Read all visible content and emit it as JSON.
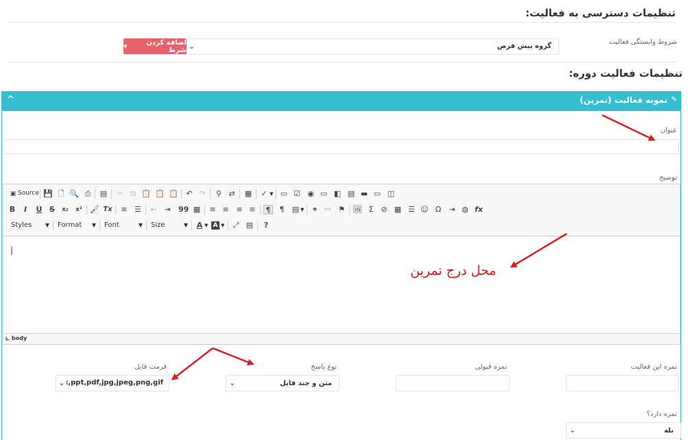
{
  "access": {
    "heading": "تنظیمات دسترسی به فعالیت:",
    "dependency_label": "شروط وابستگی فعالیت",
    "dependency_value": "گروه پیش فرض",
    "add_condition_button": "اضافه کردن شرط"
  },
  "course": {
    "heading": "تنظیمات فعالیت دوره:"
  },
  "panel": {
    "title": "نمونه فعالیت (تمرین)",
    "title_label": "عنوان",
    "description_label": "توضیح",
    "editor_placeholder": "|",
    "status_path": "body",
    "annotation_text": "محل درج تمرین"
  },
  "toolbar": {
    "source_label": "Source",
    "styles_label": "Styles",
    "format_label": "Format",
    "font_label": "Font",
    "size_label": "Size",
    "bold": "B",
    "italic": "I",
    "underline": "U",
    "strike": "S",
    "subscript": "x₂",
    "superscript": "x²",
    "remove_format": "Tx",
    "blockquote": "99",
    "help": "?",
    "omega": "Ω",
    "sigma": "Σ",
    "fx": "fx",
    "text_color": "A",
    "bg_color": "A"
  },
  "bottom": {
    "activity_score_label": "نمره این فعالیت",
    "pass_score_label": "نمره قبولی",
    "answer_type_label": "نوع پاسخ",
    "answer_type_value": "متن و چند فایل",
    "file_format_label": "فرمت فایل",
    "file_format_value": "x,pptx,ppt,pdf,jpg,jpeg,png,gif",
    "has_score_label": "نمره دارد؟",
    "has_score_value": "بله"
  },
  "colors": {
    "accent": "#35c0d1",
    "button_red": "#e5636a",
    "arrow_red": "#d62020"
  }
}
